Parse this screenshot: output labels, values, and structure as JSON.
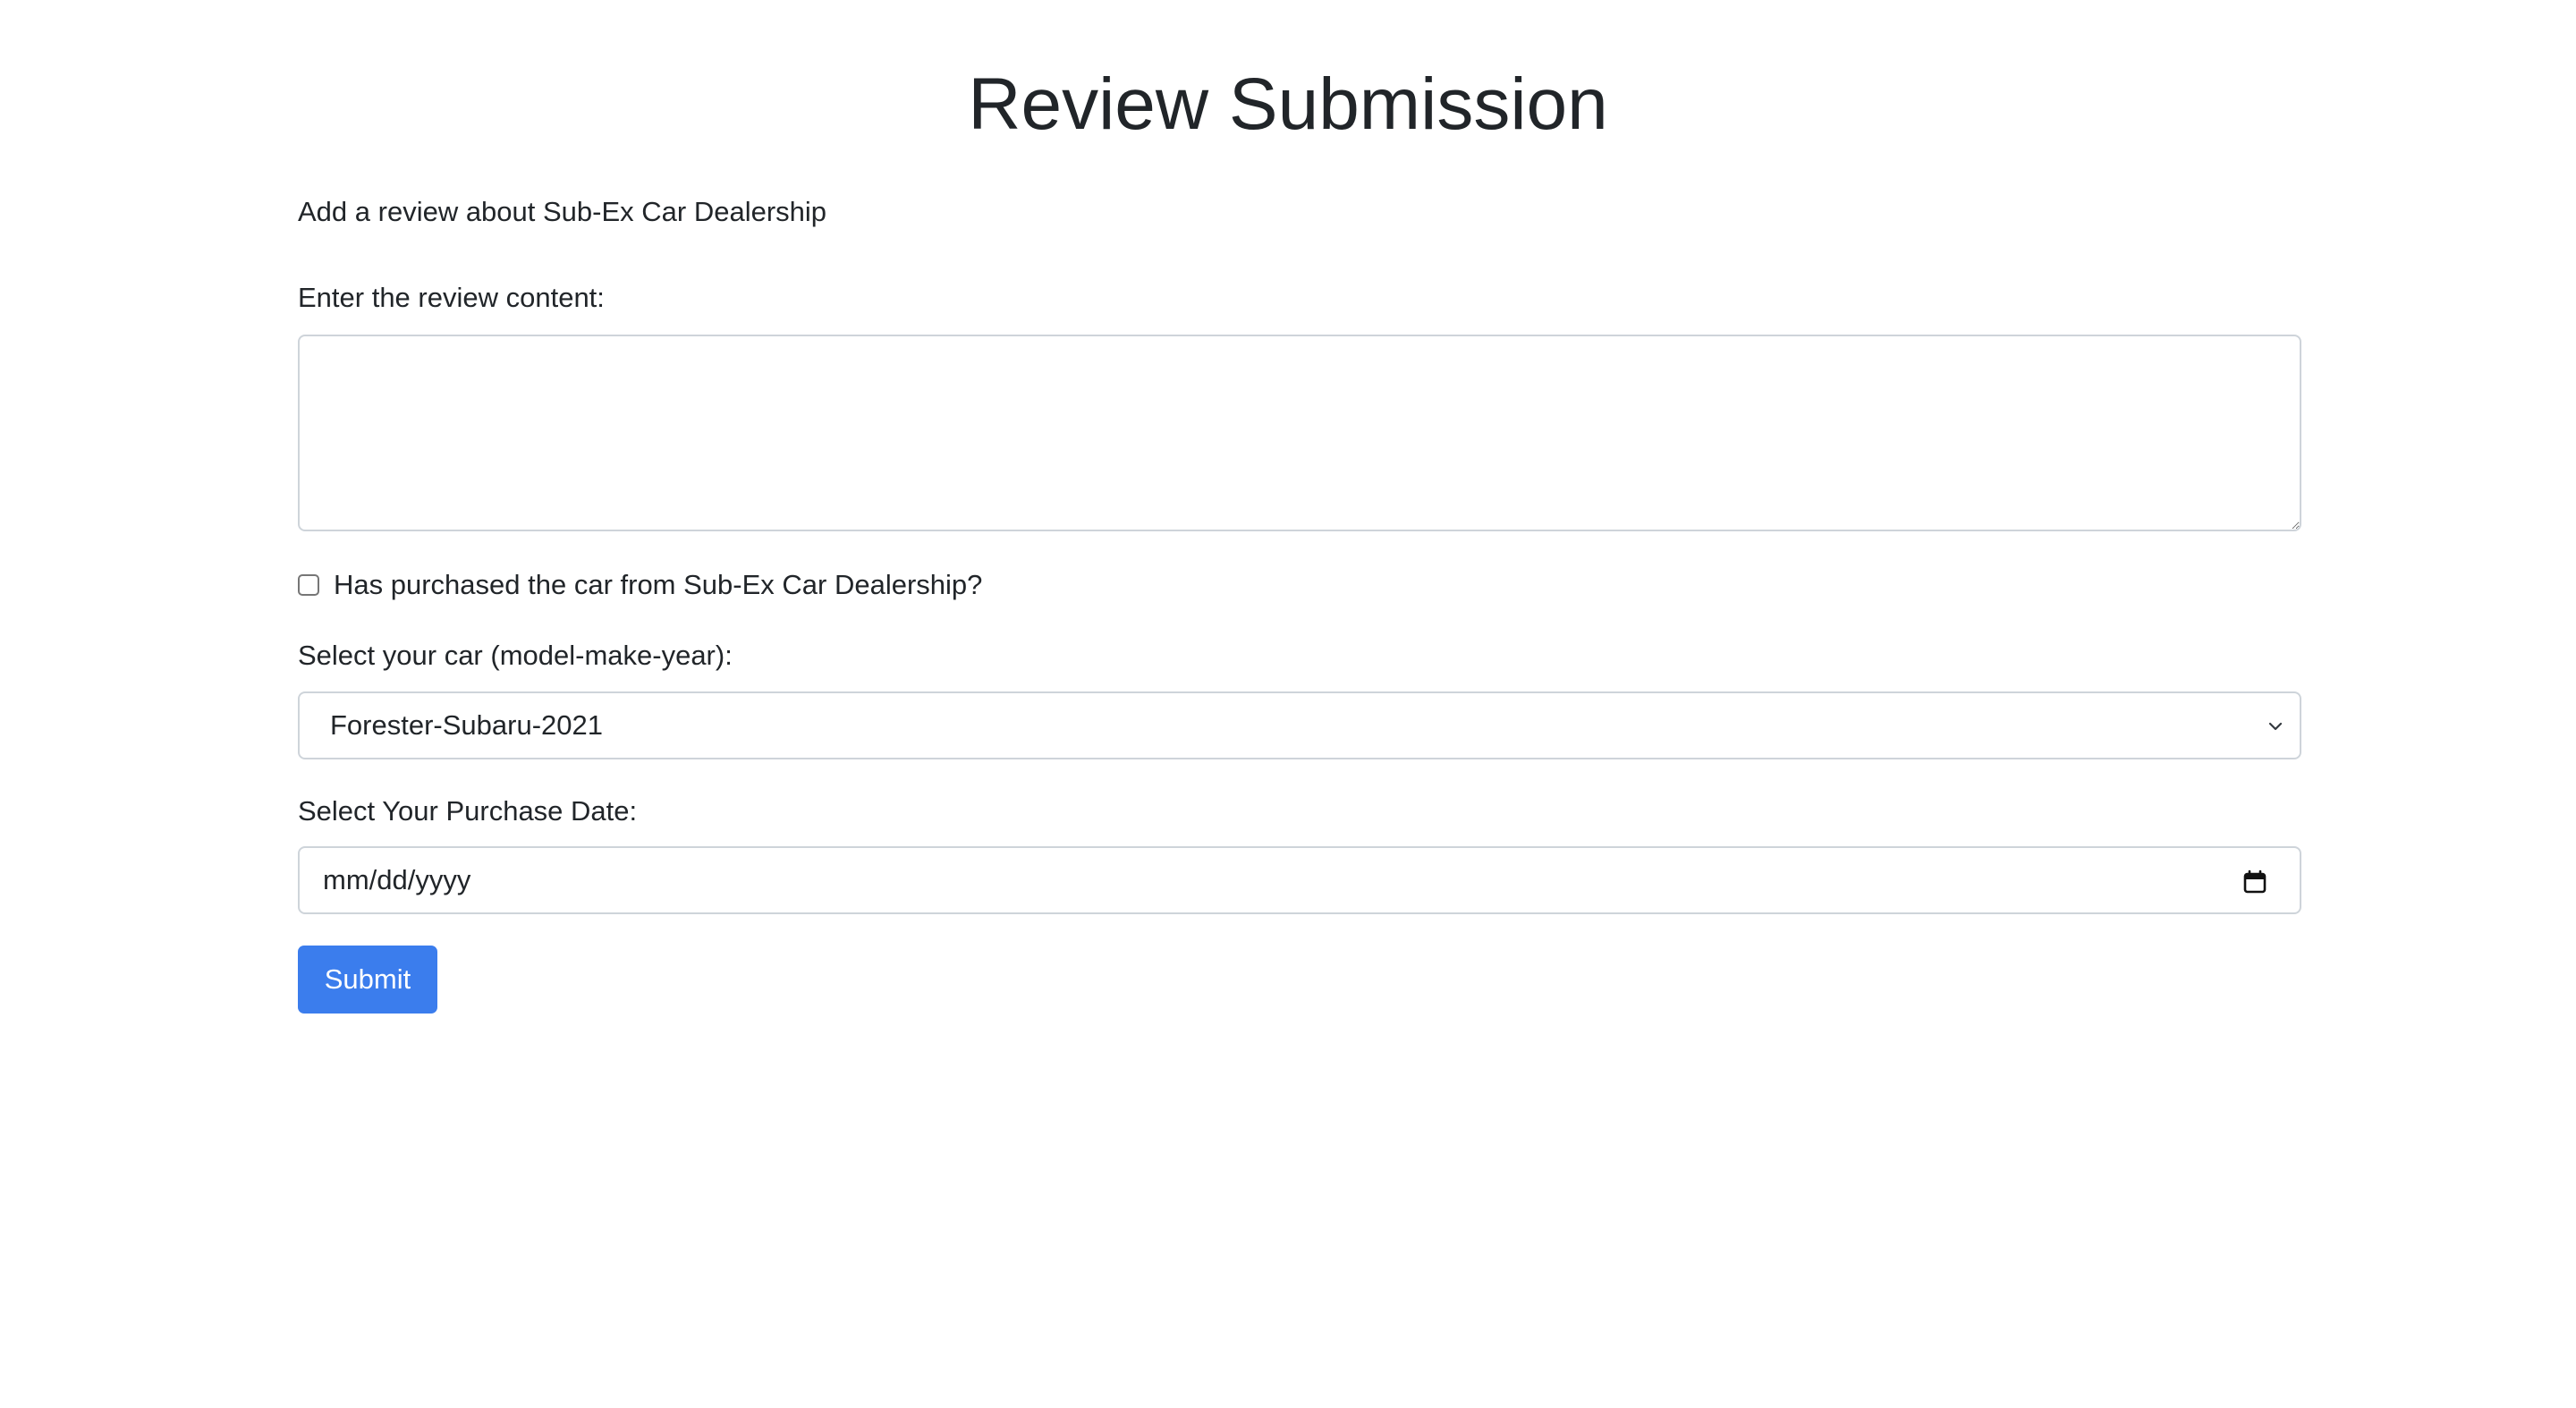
{
  "page": {
    "title": "Review Submission",
    "subtitle": "Add a review about Sub-Ex Car Dealership"
  },
  "form": {
    "review_label": "Enter the review content:",
    "review_value": "",
    "purchase_checkbox_label": "Has purchased the car from Sub-Ex Car Dealership?",
    "purchase_checked": false,
    "car_label": "Select your car (model-make-year):",
    "car_selected": "Forester-Subaru-2021",
    "date_label": "Select Your Purchase Date:",
    "date_placeholder": "mm/dd/yyyy",
    "submit_label": "Submit"
  },
  "icons": {
    "select_arrow": "chevron-down-icon",
    "date_picker": "calendar-icon",
    "resize": "resize-grip-icon"
  },
  "colors": {
    "primary": "#3b7ded",
    "border": "#ced4da",
    "text": "#212529"
  }
}
